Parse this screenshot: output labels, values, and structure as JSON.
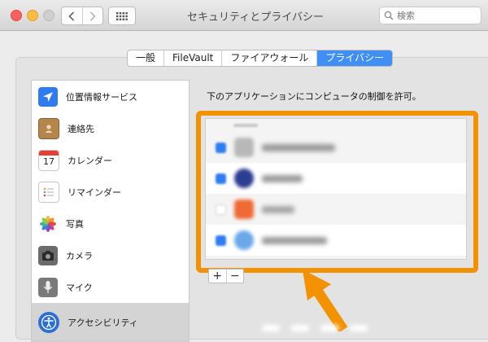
{
  "window": {
    "title": "セキュリティとプライバシー",
    "search_placeholder": "検索"
  },
  "tabs": [
    {
      "label": "一般",
      "selected": false
    },
    {
      "label": "FileVault",
      "selected": false
    },
    {
      "label": "ファイアウォール",
      "selected": false
    },
    {
      "label": "プライバシー",
      "selected": true
    }
  ],
  "sidebar": {
    "items": [
      {
        "label": "位置情報サービス",
        "icon": "location-arrow-icon"
      },
      {
        "label": "連絡先",
        "icon": "contacts-book-icon"
      },
      {
        "label": "カレンダー",
        "icon": "calendar-icon",
        "icon_text": "17"
      },
      {
        "label": "リマインダー",
        "icon": "reminders-icon"
      },
      {
        "label": "写真",
        "icon": "photos-flower-icon"
      },
      {
        "label": "カメラ",
        "icon": "camera-icon"
      },
      {
        "label": "マイク",
        "icon": "microphone-icon"
      },
      {
        "label": "アクセシビリティ",
        "icon": "accessibility-icon",
        "selected": true
      }
    ]
  },
  "main": {
    "instruction": "下のアプリケーションにコンピュータの制御を許可。",
    "apps": [
      {
        "checked": true,
        "icon": "blurred-app-icon-1"
      },
      {
        "checked": true,
        "icon": "blurred-app-icon-2"
      },
      {
        "checked": false,
        "icon": "blurred-app-icon-3"
      },
      {
        "checked": true,
        "icon": "blurred-app-icon-4"
      }
    ],
    "add_label": "+",
    "remove_label": "−"
  },
  "colors": {
    "accent": "#3f8ff5",
    "highlight": "#f39200",
    "checkbox": "#2f7df1"
  }
}
